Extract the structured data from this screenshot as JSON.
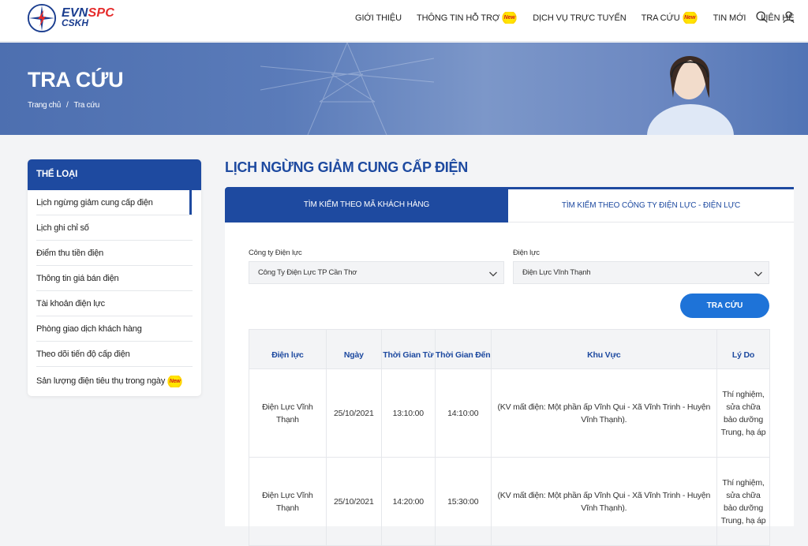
{
  "header": {
    "logo": {
      "evn": "EVN",
      "spc": "SPC",
      "cskh": "CSKH"
    },
    "nav": [
      {
        "label": "GIỚI THIỆU",
        "new": false
      },
      {
        "label": "THÔNG TIN HỖ TRỢ",
        "new": true
      },
      {
        "label": "DỊCH VỤ TRỰC TUYẾN",
        "new": false
      },
      {
        "label": "TRA CỨU",
        "new": true
      },
      {
        "label": "TIN MỚI",
        "new": false
      },
      {
        "label": "LIÊN HỆ",
        "new": false
      }
    ],
    "new_badge": "New",
    "icons": [
      "search-icon",
      "user-icon"
    ]
  },
  "banner": {
    "title": "TRA CỨU",
    "breadcrumb": [
      "Trang chủ",
      "Tra cứu"
    ],
    "breadcrumb_sep": "/"
  },
  "sidebar": {
    "heading": "THỂ LOẠI",
    "items": [
      {
        "label": "Lịch ngừng giảm cung cấp điện",
        "active": true
      },
      {
        "label": "Lịch ghi chỉ số"
      },
      {
        "label": "Điểm thu tiền điện"
      },
      {
        "label": "Thông tin giá bán điện"
      },
      {
        "label": "Tài khoản điện lực"
      },
      {
        "label": "Phòng giao dịch khách hàng"
      },
      {
        "label": "Theo dõi tiến độ cấp điện"
      },
      {
        "label": "Sản lượng điện tiêu thụ trong ngày",
        "new": true
      }
    ]
  },
  "main": {
    "title": "LỊCH NGỪNG GIẢM CUNG CẤP ĐIỆN",
    "tabs": [
      {
        "label": "TÌM KIẾM THEO MÃ KHÁCH HÀNG",
        "active": true
      },
      {
        "label": "TÌM KIẾM THEO CÔNG TY ĐIỆN LỰC - ĐIỆN LỰC",
        "active": false
      }
    ],
    "form": {
      "company_label": "Công ty Điện lực",
      "company_value": "Công Ty Điện Lực TP Cần Thơ",
      "unit_label": "Điện lực",
      "unit_value": "Điện Lực Vĩnh Thạnh",
      "search_button": "TRA CỨU"
    },
    "table": {
      "headers": [
        "Điện lực",
        "Ngày",
        "Thời Gian Từ",
        "Thời Gian Đến",
        "Khu Vực",
        "Lý Do"
      ],
      "rows": [
        [
          "Điện Lực Vĩnh Thạnh",
          "25/10/2021",
          "13:10:00",
          "14:10:00",
          "(KV mất điện: Một phần ấp Vĩnh Qui - Xã Vĩnh Trinh - Huyện Vĩnh Thạnh).",
          "Thí nghiệm, sửa chữa bảo dưỡng Trung, hạ áp"
        ],
        [
          "Điện Lực Vĩnh Thạnh",
          "25/10/2021",
          "14:20:00",
          "15:30:00",
          "(KV mất điện: Một phần ấp Vĩnh Qui - Xã Vĩnh Trinh - Huyện Vĩnh Thạnh).",
          "Thí nghiệm, sửa chữa bảo dưỡng Trung, hạ áp"
        ]
      ]
    }
  },
  "colors": {
    "primary": "#1e4aa0",
    "button": "#1e73d8",
    "logo_red": "#e52b2b",
    "badge": "#ffe600"
  }
}
